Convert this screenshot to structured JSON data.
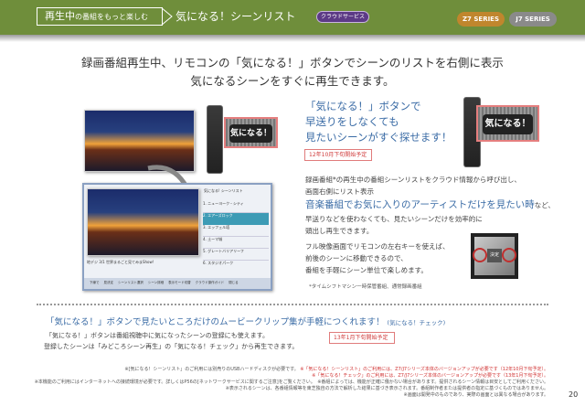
{
  "header": {
    "breadcrumb_main": "再生中",
    "breadcrumb_rest": "の番組をもっと楽しむ",
    "title": "気になる！シーンリスト",
    "cloud_badge": "クラウドサービス",
    "series": [
      "Z7 SERIES",
      "J7 SERIES"
    ]
  },
  "lead": [
    "録画番組再生中、リモコンの「気になる！」ボタンでシーンのリストを右側に表示",
    "気になるシーンをすぐに再生できます。"
  ],
  "button_label": "気になる！",
  "headline": [
    "「気になる！」ボタンで",
    "早送りをしなくても",
    "見たいシーンがすぐ探せます！"
  ],
  "release1": "12年10月下旬開始予定",
  "desc": {
    "line1": "録画番組*の再生中の番組シーンリストをクラウド情報から呼び出し、",
    "line2": "画面右側にリスト表示",
    "highlight": "音楽番組でお気に入りのアーティストだけを見たい時",
    "highlight_tail": "など、",
    "line4": "早送りなどを使わなくても、見たいシーンだけを効率的に",
    "line5": "頭出し再生できます。"
  },
  "dpad": {
    "text": [
      "フル映像画面でリモコンの左右キーを使えば、",
      "前後のシーンに移動できるので、",
      "番組を手軽にシーン単位で楽しめます。"
    ],
    "center": "決定"
  },
  "footnote1": "*タイムシフトマシン一時保管番組、通常録画番組",
  "tv": {
    "list_title": "気になる! シーンリスト",
    "items": [
      "1. ニューヨーク・シティ",
      "2. エアーズロック",
      "3. エッフェル塔",
      "4. 土ーマ城",
      "5. グレートバリアリーフ",
      "6. スタジオパーク"
    ],
    "caption": "地デジ 3/1 世界まるごと見てみまShow!",
    "footer": [
      "下線で",
      "見決定",
      "シーンリスト選択",
      "シーン詳細",
      "表示モード切替",
      "クラウド操作ガイド",
      "閉じる"
    ]
  },
  "bottom": {
    "headline": "「気になる！」ボタンで見たいところだけのムービークリップ集が手軽につくれます！",
    "headline_sub": "(気になる！チェック)",
    "line1": "「気になる！」ボタンは番組視聴中に気になったシーンの登録にも使えます。",
    "line2": "登録したシーンは「みどころシーン再生」の「気になる！チェック」から再生できます。",
    "release2": "13年1月下旬開始予定"
  },
  "notes": {
    "n1a": "※[気になる！シーンリスト」のご利用には別売りのUSBハードディスクが必要です。",
    "n1b": "※「気になる！シーンリスト」のご利用には、Z7/J7シリーズ本体のバージョンアップが必要です（12年10月下旬予定）。",
    "n2": "※「気になる！チェック」のご利用には、Z7/J7シリーズ本体のバージョンアップが必要です（13年1月下旬予定）。",
    "n3": "※本機能のご利用にはインターネットへの接続環境が必要です。詳しくはP56の[ネットワークサービスに関するご注意]をご覧ください。　※番組によっては、機能が正確に働かない場合があります。提供されるシーン情報は目安としてご利用ください。",
    "n4": "※表示されるシーンは、各番組情報等を東芝独自の方法で解析した結果に基づき表示されます。番組制作者または提供者の指定に基づくものではありません。",
    "n5": "※画面は開発中のものであり、実際の画面とは異なる場合があります。"
  },
  "page_number": "20"
}
